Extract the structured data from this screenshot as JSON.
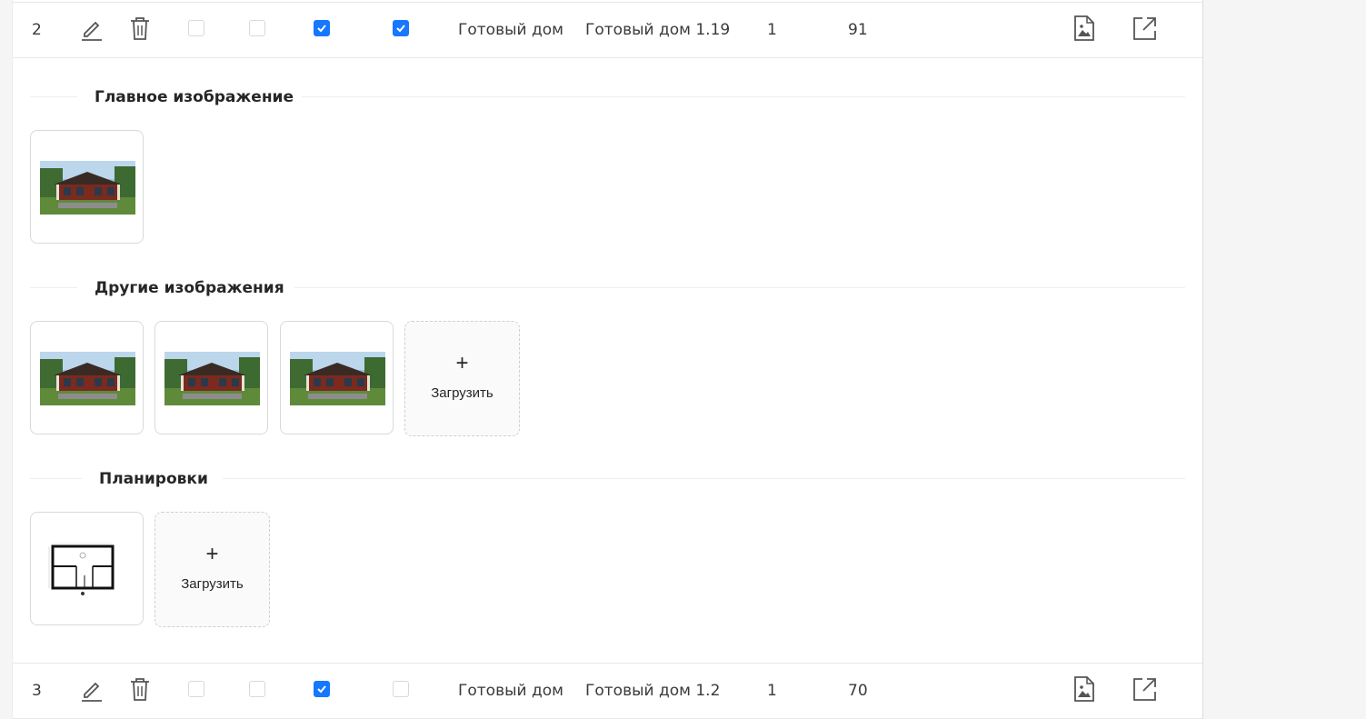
{
  "rows": [
    {
      "index": "2",
      "flags": [
        false,
        false,
        true,
        true
      ],
      "type": "Готовый дом",
      "name": "Готовый дом 1.19",
      "floors": "1",
      "area": "91"
    },
    {
      "index": "3",
      "flags": [
        false,
        false,
        true,
        false
      ],
      "type": "Готовый дом",
      "name": "Готовый дом 1.2",
      "floors": "1",
      "area": "70"
    }
  ],
  "sections": {
    "main_image": {
      "title": "Главное изображение"
    },
    "other_images": {
      "title": "Другие изображения",
      "upload_label": "Загрузить",
      "upload_plus": "+"
    },
    "plans": {
      "title": "Планировки",
      "upload_label": "Загрузить",
      "upload_plus": "+"
    }
  },
  "colors": {
    "accent": "#1677ff",
    "border": "#d9d9d9",
    "icon": "#555555"
  },
  "icons": [
    "edit-icon",
    "trash-icon",
    "image-file-icon",
    "external-link-icon",
    "plus-icon"
  ]
}
